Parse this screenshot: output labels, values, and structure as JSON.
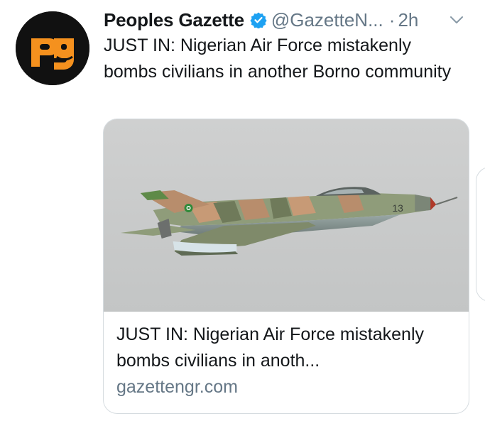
{
  "tweet": {
    "display_name": "Peoples Gazette",
    "handle": "@GazetteN...",
    "separator": "·",
    "time": "2h",
    "text": "JUST IN: Nigerian Air Force mistakenly bombs civilians in another Borno community",
    "avatar_icon": "pg-logo-icon",
    "verified_icon": "verified-badge-icon",
    "menu_icon": "chevron-down-icon"
  },
  "card": {
    "image_icon": "fighter-jet-photo",
    "title": "JUST IN: Nigerian Air Force mistakenly bombs civilians in anoth...",
    "domain": "gazettengr.com"
  },
  "colors": {
    "text": "#14171a",
    "secondary": "#657786",
    "verified": "#1da1f2",
    "logo_orange": "#f5911e",
    "avatar_bg": "#111111",
    "card_border": "#d6dce0"
  }
}
